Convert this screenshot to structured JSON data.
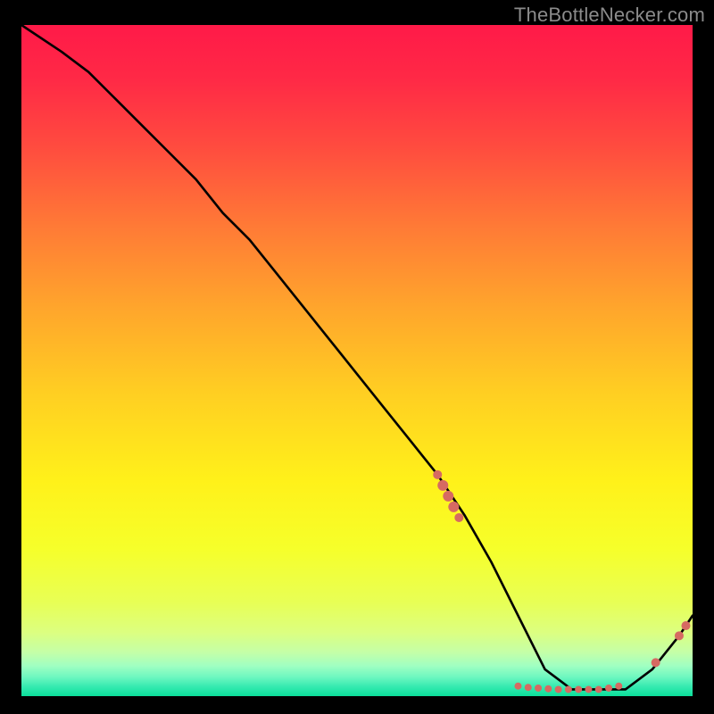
{
  "watermark": {
    "text": "TheBottleNecker.com"
  },
  "chart_data": {
    "type": "line",
    "xlim": [
      0,
      100
    ],
    "ylim": [
      0,
      100
    ],
    "grid": false,
    "legend": false,
    "title": "",
    "xlabel": "",
    "ylabel": "",
    "line": {
      "name": "bottleneck-curve",
      "color": "#000000",
      "x": [
        0,
        6,
        10,
        14,
        18,
        22,
        26,
        30,
        34,
        38,
        42,
        46,
        50,
        54,
        58,
        62,
        66,
        70,
        74,
        78,
        82,
        86,
        90,
        94,
        98,
        100
      ],
      "y": [
        100,
        96,
        93,
        89,
        85,
        81,
        77,
        72,
        68,
        63,
        58,
        53,
        48,
        43,
        38,
        33,
        27,
        20,
        12,
        4,
        1,
        1,
        1,
        4,
        9,
        12
      ]
    },
    "markers": {
      "name": "highlight-points",
      "color": "#d66a62",
      "points": [
        {
          "x": 62.0,
          "y": 33.0,
          "r": 5
        },
        {
          "x": 62.8,
          "y": 31.4,
          "r": 6
        },
        {
          "x": 63.6,
          "y": 29.8,
          "r": 6
        },
        {
          "x": 64.4,
          "y": 28.2,
          "r": 6
        },
        {
          "x": 65.2,
          "y": 26.6,
          "r": 5
        },
        {
          "x": 74.0,
          "y": 1.5,
          "r": 4
        },
        {
          "x": 75.5,
          "y": 1.3,
          "r": 4
        },
        {
          "x": 77.0,
          "y": 1.2,
          "r": 4
        },
        {
          "x": 78.5,
          "y": 1.1,
          "r": 4
        },
        {
          "x": 80.0,
          "y": 1.0,
          "r": 4
        },
        {
          "x": 81.5,
          "y": 1.0,
          "r": 4
        },
        {
          "x": 83.0,
          "y": 1.0,
          "r": 4
        },
        {
          "x": 84.5,
          "y": 1.0,
          "r": 4
        },
        {
          "x": 86.0,
          "y": 1.0,
          "r": 4
        },
        {
          "x": 87.5,
          "y": 1.2,
          "r": 4
        },
        {
          "x": 89.0,
          "y": 1.5,
          "r": 4
        },
        {
          "x": 94.5,
          "y": 5.0,
          "r": 5
        },
        {
          "x": 98.0,
          "y": 9.0,
          "r": 5
        },
        {
          "x": 99.0,
          "y": 10.5,
          "r": 5
        }
      ]
    },
    "background_gradient": {
      "stops": [
        {
          "offset": 0.0,
          "color": "#ff1a48"
        },
        {
          "offset": 0.08,
          "color": "#ff2946"
        },
        {
          "offset": 0.18,
          "color": "#ff4b3f"
        },
        {
          "offset": 0.3,
          "color": "#ff7a36"
        },
        {
          "offset": 0.42,
          "color": "#ffa52c"
        },
        {
          "offset": 0.55,
          "color": "#ffcf22"
        },
        {
          "offset": 0.68,
          "color": "#fff11a"
        },
        {
          "offset": 0.78,
          "color": "#f6ff2a"
        },
        {
          "offset": 0.86,
          "color": "#e8ff55"
        },
        {
          "offset": 0.905,
          "color": "#dcff80"
        },
        {
          "offset": 0.935,
          "color": "#c4ffa8"
        },
        {
          "offset": 0.955,
          "color": "#a0ffc2"
        },
        {
          "offset": 0.972,
          "color": "#6cf7c0"
        },
        {
          "offset": 0.986,
          "color": "#35eab0"
        },
        {
          "offset": 1.0,
          "color": "#0bdf9a"
        }
      ]
    }
  }
}
